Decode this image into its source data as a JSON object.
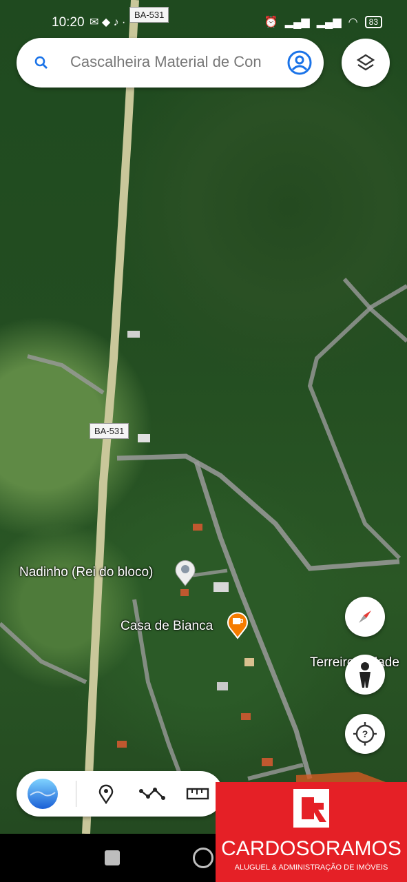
{
  "status_bar": {
    "time": "10:20",
    "battery": "83"
  },
  "search": {
    "placeholder": "Cascalheira Material de Con"
  },
  "roads": {
    "top_label": "BA-531",
    "mid_label": "BA-531"
  },
  "places": [
    {
      "name": "Nadinho (Rei do bloco)"
    },
    {
      "name": "Casa de Bianca"
    },
    {
      "name": "Terreiro Cidade"
    }
  ],
  "brand": {
    "name": "CARDOSORAMOS",
    "tagline": "ALUGUEL & ADMINISTRAÇÃO DE IMÓVEIS"
  },
  "colors": {
    "accent": "#1a73e8",
    "brand_red": "#e52026",
    "cafe_pin": "#f57c00"
  }
}
